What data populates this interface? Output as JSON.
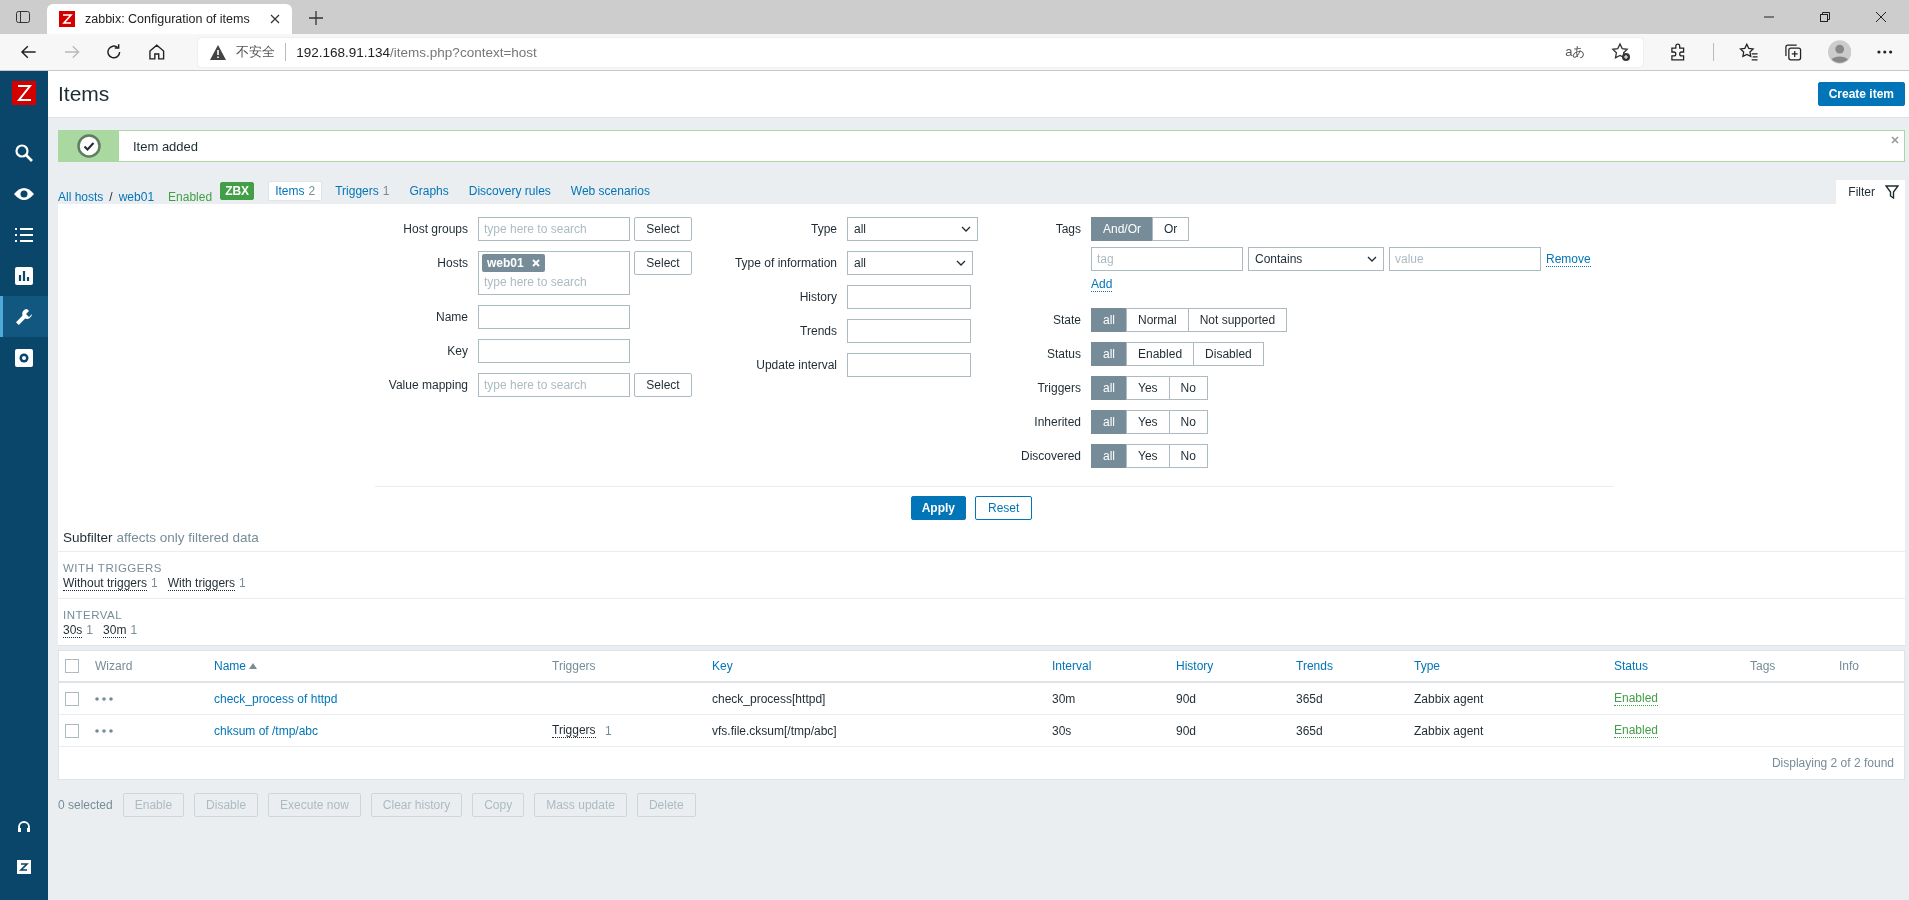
{
  "browser": {
    "tab_title": "zabbix: Configuration of items",
    "security_label": "不安全",
    "url_host": "192.168.91.134",
    "url_path": "/items.php?context=host",
    "translate_label": "aあ"
  },
  "sidebar": {
    "items": [
      {
        "kind": "search",
        "selected": false
      },
      {
        "kind": "monitoring",
        "selected": false
      },
      {
        "kind": "inventory",
        "selected": false
      },
      {
        "kind": "reports",
        "selected": false
      },
      {
        "kind": "configuration",
        "selected": true
      },
      {
        "kind": "administration",
        "selected": false
      }
    ]
  },
  "page": {
    "title": "Items",
    "create_button": "Create item"
  },
  "message": {
    "text": "Item added"
  },
  "nav": {
    "all_hosts": "All hosts",
    "separator": "/",
    "host": "web01",
    "host_status": "Enabled",
    "badge": "ZBX",
    "tabs": [
      {
        "label": "Items",
        "count": "2",
        "selected": true
      },
      {
        "label": "Triggers",
        "count": "1",
        "selected": false
      },
      {
        "label": "Graphs",
        "selected": false
      },
      {
        "label": "Discovery rules",
        "selected": false
      },
      {
        "label": "Web scenarios",
        "selected": false
      }
    ],
    "filter_tab": {
      "label": "Filter",
      "expanded": true
    }
  },
  "filter": {
    "columns": [
      [
        {
          "label": "Host groups",
          "kind": "search",
          "placeholder": "type here to search",
          "button": "Select"
        },
        {
          "label": "Hosts",
          "kind": "multiselect",
          "chips": [
            "web01"
          ],
          "placeholder": "type here to search",
          "button": "Select"
        },
        {
          "label": "Name",
          "kind": "text"
        },
        {
          "label": "Key",
          "kind": "text"
        },
        {
          "label": "Value mapping",
          "kind": "search",
          "placeholder": "type here to search",
          "button": "Select"
        }
      ],
      [
        {
          "label": "Type",
          "kind": "select",
          "value": "all"
        },
        {
          "label": "Type of information",
          "kind": "select",
          "value": "all"
        },
        {
          "label": "History",
          "kind": "text"
        },
        {
          "label": "Trends",
          "kind": "text"
        },
        {
          "label": "Update interval",
          "kind": "text"
        }
      ],
      [
        {
          "label": "Tags",
          "kind": "tags",
          "options": [
            {
              "label": "And/Or",
              "selected": true
            },
            {
              "label": "Or",
              "selected": false
            }
          ],
          "conditions": [
            {
              "tag_placeholder": "tag",
              "operator": "Contains",
              "value_placeholder": "value",
              "remove": "Remove"
            }
          ],
          "add": "Add"
        },
        {
          "label": "State",
          "kind": "radio",
          "options": [
            {
              "label": "all",
              "selected": true
            },
            {
              "label": "Normal",
              "selected": false
            },
            {
              "label": "Not supported",
              "selected": false
            }
          ]
        },
        {
          "label": "Status",
          "kind": "radio",
          "options": [
            {
              "label": "all",
              "selected": true
            },
            {
              "label": "Enabled",
              "selected": false
            },
            {
              "label": "Disabled",
              "selected": false
            }
          ]
        },
        {
          "label": "Triggers",
          "kind": "radio",
          "options": [
            {
              "label": "all",
              "selected": true
            },
            {
              "label": "Yes",
              "selected": false
            },
            {
              "label": "No",
              "selected": false
            }
          ]
        },
        {
          "label": "Inherited",
          "kind": "radio",
          "options": [
            {
              "label": "all",
              "selected": true
            },
            {
              "label": "Yes",
              "selected": false
            },
            {
              "label": "No",
              "selected": false
            }
          ]
        },
        {
          "label": "Discovered",
          "kind": "radio",
          "options": [
            {
              "label": "all",
              "selected": true
            },
            {
              "label": "Yes",
              "selected": false
            },
            {
              "label": "No",
              "selected": false
            }
          ]
        }
      ]
    ],
    "apply": "Apply",
    "reset": "Reset"
  },
  "subfilter": {
    "title": "Subfilter",
    "note": "affects only filtered data",
    "groups": [
      {
        "heading": "WITH TRIGGERS",
        "options": [
          {
            "label": "Without triggers",
            "count": "1"
          },
          {
            "label": "With triggers",
            "count": "1"
          }
        ]
      },
      {
        "heading": "INTERVAL",
        "options": [
          {
            "label": "30s",
            "count": "1"
          },
          {
            "label": "30m",
            "count": "1"
          }
        ]
      }
    ]
  },
  "table": {
    "select_all_checked": false,
    "columns": [
      {
        "label": "Wizard",
        "sortable": false,
        "sorted": false
      },
      {
        "label": "Name",
        "sortable": true,
        "sorted": true
      },
      {
        "label": "Triggers",
        "sortable": false,
        "sorted": false
      },
      {
        "label": "Key",
        "sortable": true,
        "sorted": false
      },
      {
        "label": "Interval",
        "sortable": true,
        "sorted": false
      },
      {
        "label": "History",
        "sortable": true,
        "sorted": false
      },
      {
        "label": "Trends",
        "sortable": true,
        "sorted": false
      },
      {
        "label": "Type",
        "sortable": true,
        "sorted": false
      },
      {
        "label": "Status",
        "sortable": true,
        "sorted": false
      },
      {
        "label": "Tags",
        "sortable": false,
        "sorted": false
      },
      {
        "label": "Info",
        "sortable": false,
        "sorted": false
      }
    ],
    "rows": [
      {
        "checked": false,
        "name": "check_process of httpd",
        "key": "check_process[httpd]",
        "interval": "30m",
        "history": "90d",
        "trends": "365d",
        "type": "Zabbix agent",
        "status": {
          "label": "Enabled",
          "enabled": true
        }
      },
      {
        "checked": false,
        "name": "chksum of /tmp/abc",
        "triggers": {
          "label": "Triggers",
          "count": "1"
        },
        "key": "vfs.file.cksum[/tmp/abc]",
        "interval": "30s",
        "history": "90d",
        "trends": "365d",
        "type": "Zabbix agent",
        "status": {
          "label": "Enabled",
          "enabled": true
        }
      }
    ],
    "footer": "Displaying 2 of 2 found"
  },
  "actions": {
    "selected_count": "0 selected",
    "buttons": [
      {
        "label": "Enable",
        "disabled": true
      },
      {
        "label": "Disable",
        "disabled": true
      },
      {
        "label": "Execute now",
        "disabled": true
      },
      {
        "label": "Clear history",
        "disabled": true
      },
      {
        "label": "Copy",
        "disabled": true
      },
      {
        "label": "Mass update",
        "disabled": true
      },
      {
        "label": "Delete",
        "disabled": true
      }
    ]
  }
}
